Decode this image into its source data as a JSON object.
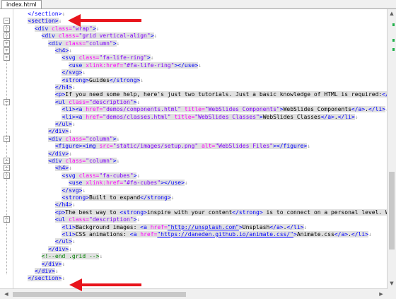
{
  "tab": {
    "label": "index.html"
  },
  "lines": [
    [
      [
        "t",
        "</section>"
      ],
      [
        "eol",
        "↓"
      ]
    ],
    [
      [
        "t",
        "<section>"
      ],
      [
        "eol",
        "↓"
      ]
    ],
    [
      [
        "t",
        "<div "
      ],
      [
        "a",
        "class="
      ],
      [
        "v",
        "\"wrap\""
      ],
      [
        "t",
        ">"
      ],
      [
        "eol",
        "↓"
      ]
    ],
    [
      [
        "t",
        "<div "
      ],
      [
        "a",
        "class="
      ],
      [
        "v",
        "\"grid vertical-align\""
      ],
      [
        "t",
        ">"
      ],
      [
        "eol",
        "↓"
      ]
    ],
    [
      [
        "t",
        "<div "
      ],
      [
        "a",
        "class="
      ],
      [
        "v",
        "\"column\""
      ],
      [
        "t",
        ">"
      ],
      [
        "eol",
        "↓"
      ]
    ],
    [
      [
        "t",
        "<h4>"
      ],
      [
        "eol",
        "↓"
      ]
    ],
    [
      [
        "t",
        "<svg "
      ],
      [
        "a",
        "class="
      ],
      [
        "v",
        "\"fa-life-ring\""
      ],
      [
        "t",
        ">"
      ],
      [
        "eol",
        "↓"
      ]
    ],
    [
      [
        "t",
        "<use "
      ],
      [
        "a",
        "xlink:href="
      ],
      [
        "v",
        "\"#fa-life-ring\""
      ],
      [
        "t",
        "></use>"
      ],
      [
        "eol",
        "↓"
      ]
    ],
    [
      [
        "t",
        "</svg>"
      ],
      [
        "eol",
        "↓"
      ]
    ],
    [
      [
        "t",
        "<strong>"
      ],
      [
        "x",
        "Guides"
      ],
      [
        "t",
        "</strong>"
      ],
      [
        "eol",
        "↓"
      ]
    ],
    [
      [
        "t",
        "</h4>"
      ],
      [
        "eol",
        "↓"
      ]
    ],
    [
      [
        "t",
        "<p>"
      ],
      [
        "x",
        "If you need some help, here's just two tutorials. Just a basic knowledge of HTML is required:"
      ],
      [
        "t",
        "</p>"
      ],
      [
        "eol",
        "↓"
      ]
    ],
    [
      [
        "t",
        "<ul "
      ],
      [
        "a",
        "class="
      ],
      [
        "v",
        "\"description\""
      ],
      [
        "t",
        ">"
      ],
      [
        "eol",
        "↓"
      ]
    ],
    [
      [
        "t",
        "<li><a "
      ],
      [
        "a",
        "href="
      ],
      [
        "v",
        "\"demos/components.html\" "
      ],
      [
        "a",
        "title="
      ],
      [
        "v",
        "\"WebSlides Components\""
      ],
      [
        "t",
        ">"
      ],
      [
        "x",
        "WebSlides Components"
      ],
      [
        "t",
        "</a>"
      ],
      [
        "x",
        "."
      ],
      [
        "t",
        "</li>"
      ],
      [
        "eol",
        "↓"
      ]
    ],
    [
      [
        "t",
        "<li><a "
      ],
      [
        "a",
        "href="
      ],
      [
        "v",
        "\"demos/classes.html\" "
      ],
      [
        "a",
        "title="
      ],
      [
        "v",
        "\"WebSlides Classes\""
      ],
      [
        "t",
        ">"
      ],
      [
        "x",
        "WebSlides Classes"
      ],
      [
        "t",
        "</a>"
      ],
      [
        "x",
        "."
      ],
      [
        "t",
        "</li>"
      ],
      [
        "eol",
        "↓"
      ]
    ],
    [
      [
        "t",
        "</ul>"
      ],
      [
        "eol",
        "↓"
      ]
    ],
    [
      [
        "t",
        "</div>"
      ],
      [
        "eol",
        "↓"
      ]
    ],
    [
      [
        "t",
        "<div "
      ],
      [
        "a",
        "class="
      ],
      [
        "v",
        "\"column\""
      ],
      [
        "t",
        ">"
      ],
      [
        "eol",
        "↓"
      ]
    ],
    [
      [
        "t",
        "<figure><img "
      ],
      [
        "a",
        "src="
      ],
      [
        "v",
        "\"static/images/setup.png\" "
      ],
      [
        "a",
        "alt="
      ],
      [
        "v",
        "\"WebSlides Files\""
      ],
      [
        "t",
        "></figure>"
      ],
      [
        "eol",
        "↓"
      ]
    ],
    [
      [
        "t",
        "</div>"
      ],
      [
        "eol",
        "↓"
      ]
    ],
    [
      [
        "t",
        "<div "
      ],
      [
        "a",
        "class="
      ],
      [
        "v",
        "\"column\""
      ],
      [
        "t",
        ">"
      ],
      [
        "eol",
        "↓"
      ]
    ],
    [
      [
        "t",
        "<h4>"
      ],
      [
        "eol",
        "↓"
      ]
    ],
    [
      [
        "t",
        "<svg "
      ],
      [
        "a",
        "class="
      ],
      [
        "v",
        "\"fa-cubes\""
      ],
      [
        "t",
        ">"
      ],
      [
        "eol",
        "↓"
      ]
    ],
    [
      [
        "t",
        "<use "
      ],
      [
        "a",
        "xlink:href="
      ],
      [
        "v",
        "\"#fa-cubes\""
      ],
      [
        "t",
        "></use>"
      ],
      [
        "eol",
        "↓"
      ]
    ],
    [
      [
        "t",
        "</svg>"
      ],
      [
        "eol",
        "↓"
      ]
    ],
    [
      [
        "t",
        "<strong>"
      ],
      [
        "x",
        "Built to expand"
      ],
      [
        "t",
        "</strong>"
      ],
      [
        "eol",
        "↓"
      ]
    ],
    [
      [
        "t",
        "</h4>"
      ],
      [
        "eol",
        "↓"
      ]
    ],
    [
      [
        "t",
        "<p>"
      ],
      [
        "x",
        "The best way to "
      ],
      [
        "t",
        "<strong>"
      ],
      [
        "x",
        "inspire with your content"
      ],
      [
        "t",
        "</strong>"
      ],
      [
        "x",
        " is to connect on a personal level. We lov"
      ]
    ],
    [
      [
        "t",
        "<ul "
      ],
      [
        "a",
        "class="
      ],
      [
        "v",
        "\"description\""
      ],
      [
        "t",
        ">"
      ],
      [
        "eol",
        "↓"
      ]
    ],
    [
      [
        "t",
        "<li>"
      ],
      [
        "x",
        "Background images: "
      ],
      [
        "t",
        "<a "
      ],
      [
        "a",
        "href="
      ],
      [
        "u",
        "\"http://unsplash.com\""
      ],
      [
        "t",
        ">"
      ],
      [
        "x",
        "Unsplash"
      ],
      [
        "t",
        "</a>"
      ],
      [
        "x",
        "."
      ],
      [
        "t",
        "</li>"
      ],
      [
        "eol",
        "↓"
      ]
    ],
    [
      [
        "t",
        "<li>"
      ],
      [
        "x",
        "CSS animations: "
      ],
      [
        "t",
        "<a "
      ],
      [
        "a",
        "href="
      ],
      [
        "u",
        "\"https://daneden.github.io/animate.css/\""
      ],
      [
        "t",
        ">"
      ],
      [
        "x",
        "Animate.css"
      ],
      [
        "t",
        "</a>"
      ],
      [
        "x",
        "."
      ],
      [
        "t",
        "</li>"
      ],
      [
        "eol",
        "↓"
      ]
    ],
    [
      [
        "t",
        "</ul>"
      ],
      [
        "eol",
        "↓"
      ]
    ],
    [
      [
        "t",
        "</div>"
      ],
      [
        "eol",
        "↓"
      ]
    ],
    [
      [
        "cm",
        "<!--end .grid -->"
      ],
      [
        "eol",
        "↓"
      ]
    ],
    [
      [
        "t",
        "</div>"
      ],
      [
        "eol",
        "↓"
      ]
    ],
    [
      [
        "t",
        "</div>"
      ],
      [
        "eol",
        "↓"
      ]
    ],
    [
      [
        "t",
        "</section>"
      ],
      [
        "eol",
        "↓"
      ]
    ]
  ]
}
